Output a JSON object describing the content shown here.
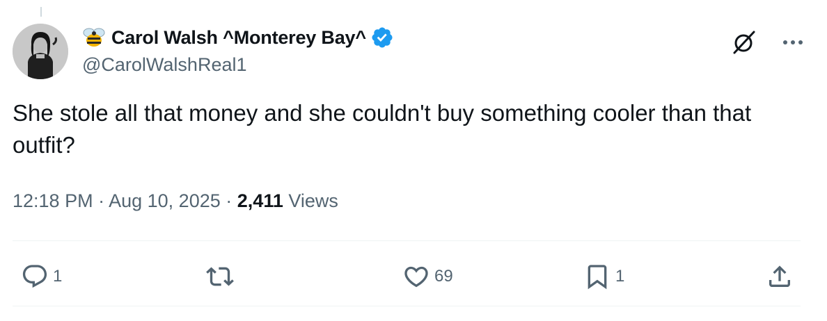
{
  "author": {
    "display_name": "Carol Walsh ^Monterey Bay^",
    "handle": "@CarolWalshReal1",
    "verified": true,
    "name_emoji": "bee-icon",
    "verified_color": "#1d9bf0"
  },
  "tweet": {
    "text": "She stole all that money and she couldn't buy something cooler than that outfit?",
    "time": "12:18 PM",
    "date": "Aug 10, 2025",
    "views_count": "2,411",
    "views_label": "Views",
    "separator": "·"
  },
  "header_icons": {
    "grok": "grok-icon",
    "more": "more-icon"
  },
  "actions": {
    "reply": {
      "icon": "reply-icon",
      "count": "1"
    },
    "retweet": {
      "icon": "retweet-icon",
      "count": ""
    },
    "like": {
      "icon": "heart-icon",
      "count": "69"
    },
    "bookmark": {
      "icon": "bookmark-icon",
      "count": "1"
    },
    "share": {
      "icon": "share-icon",
      "count": ""
    }
  },
  "colors": {
    "text_primary": "#0f1419",
    "text_secondary": "#536471",
    "divider": "#eff3f4",
    "verified": "#1d9bf0"
  }
}
